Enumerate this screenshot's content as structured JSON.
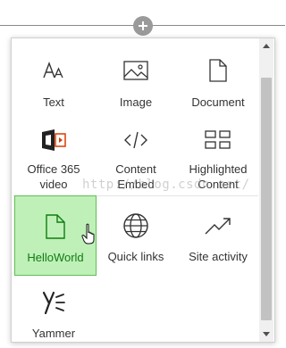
{
  "toolbox": {
    "tiles": [
      {
        "label": "Text",
        "icon": "text-size-icon"
      },
      {
        "label": "Image",
        "icon": "image-icon"
      },
      {
        "label": "Document",
        "icon": "document-icon"
      },
      {
        "label": "Office 365\nvideo",
        "icon": "office365-video-icon"
      },
      {
        "label": "Content\nEmbed",
        "icon": "code-icon"
      },
      {
        "label": "Highlighted\nContent",
        "icon": "highlighted-content-icon"
      },
      {
        "label": "HelloWorld",
        "icon": "document-icon",
        "selected": true
      },
      {
        "label": "Quick links",
        "icon": "globe-icon"
      },
      {
        "label": "Site activity",
        "icon": "trend-icon"
      },
      {
        "label": "Yammer",
        "icon": "yammer-icon"
      }
    ]
  },
  "watermark": "http://blog.csdn.net/",
  "colors": {
    "selected_bg": "#bff0b8",
    "selected_border": "#5fbf53",
    "selected_text": "#107c10",
    "office_red": "#d83b01"
  }
}
